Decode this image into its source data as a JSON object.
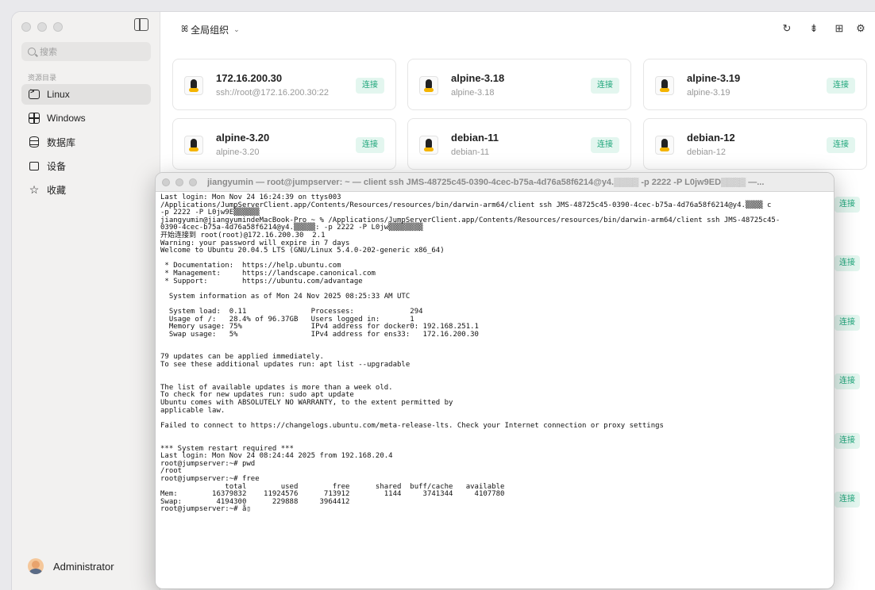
{
  "sidebar": {
    "search_placeholder": "搜索",
    "section_label": "资源目录",
    "items": [
      {
        "label": "Linux",
        "icon": "terminal-icon",
        "active": true
      },
      {
        "label": "Windows",
        "icon": "windows-icon"
      },
      {
        "label": "数据库",
        "icon": "database-icon"
      },
      {
        "label": "设备",
        "icon": "device-icon"
      },
      {
        "label": "收藏",
        "icon": "star-icon"
      }
    ],
    "user_name": "Administrator"
  },
  "header": {
    "org_label": "全局组织",
    "icons": [
      "refresh-icon",
      "sort-icon",
      "grid-view-icon",
      "settings-icon"
    ]
  },
  "accent_color": "#1ea57a",
  "connect_label": "连接",
  "cards": [
    {
      "name": "172.16.200.30",
      "sub": "ssh://root@172.16.200.30:22"
    },
    {
      "name": "alpine-3.18",
      "sub": "alpine-3.18"
    },
    {
      "name": "alpine-3.19",
      "sub": "alpine-3.19"
    },
    {
      "name": "alpine-3.20",
      "sub": "alpine-3.20"
    },
    {
      "name": "debian-11",
      "sub": "debian-11"
    },
    {
      "name": "debian-12",
      "sub": "debian-12"
    }
  ],
  "terminal": {
    "title": "jiangyumin — root@jumpserver: ~ — client ssh JMS-48725c45-0390-4cec-b75a-4d76a58f6214@y4.▒▒▒▒ -p 2222 -P L0jw9ED▒▒▒▒ —...",
    "lines": [
      "Last login: Mon Nov 24 16:24:39 on ttys003",
      "/Applications/JumpServerClient.app/Contents/Resources/resources/bin/darwin-arm64/client ssh JMS-48725c45-0390-4cec-b75a-4d76a58f6214@y4.▒▒▒▒ c",
      "-p 2222 -P L0jw9E▒▒▒▒▒▒",
      "jiangyumin@jiangyumindeMacBook-Pro ~ % /Applications/JumpServerClient.app/Contents/Resources/resources/bin/darwin-arm64/client ssh JMS-48725c45-",
      "0390-4cec-b75a-4d76a58f6214@y4.▒▒▒▒▒: -p 2222 -P L0jw▒▒▒▒▒▒▒▒",
      "开始连接到 root(root)@172.16.200.30  2.1",
      "Warning: your password will expire in 7 days",
      "Welcome to Ubuntu 20.04.5 LTS (GNU/Linux 5.4.0-202-generic x86_64)",
      "",
      " * Documentation:  https://help.ubuntu.com",
      " * Management:     https://landscape.canonical.com",
      " * Support:        https://ubuntu.com/advantage",
      "",
      "  System information as of Mon 24 Nov 2025 08:25:33 AM UTC",
      "",
      "  System load:  0.11               Processes:             294",
      "  Usage of /:   28.4% of 96.37GB   Users logged in:       1",
      "  Memory usage: 75%                IPv4 address for docker0: 192.168.251.1",
      "  Swap usage:   5%                 IPv4 address for ens33:   172.16.200.30",
      "",
      "",
      "79 updates can be applied immediately.",
      "To see these additional updates run: apt list --upgradable",
      "",
      "",
      "The list of available updates is more than a week old.",
      "To check for new updates run: sudo apt update",
      "Ubuntu comes with ABSOLUTELY NO WARRANTY, to the extent permitted by",
      "applicable law.",
      "",
      "Failed to connect to https://changelogs.ubuntu.com/meta-release-lts. Check your Internet connection or proxy settings",
      "",
      "",
      "*** System restart required ***",
      "Last login: Mon Nov 24 08:24:44 2025 from 192.168.20.4",
      "root@jumpserver:~# pwd",
      "/root",
      "root@jumpserver:~# free",
      "               total        used        free      shared  buff/cache   available",
      "Mem:        16379832    11924576      713912        1144     3741344     4107780",
      "Swap:        4194300      229888     3964412",
      "root@jumpserver:~# å▯"
    ]
  }
}
